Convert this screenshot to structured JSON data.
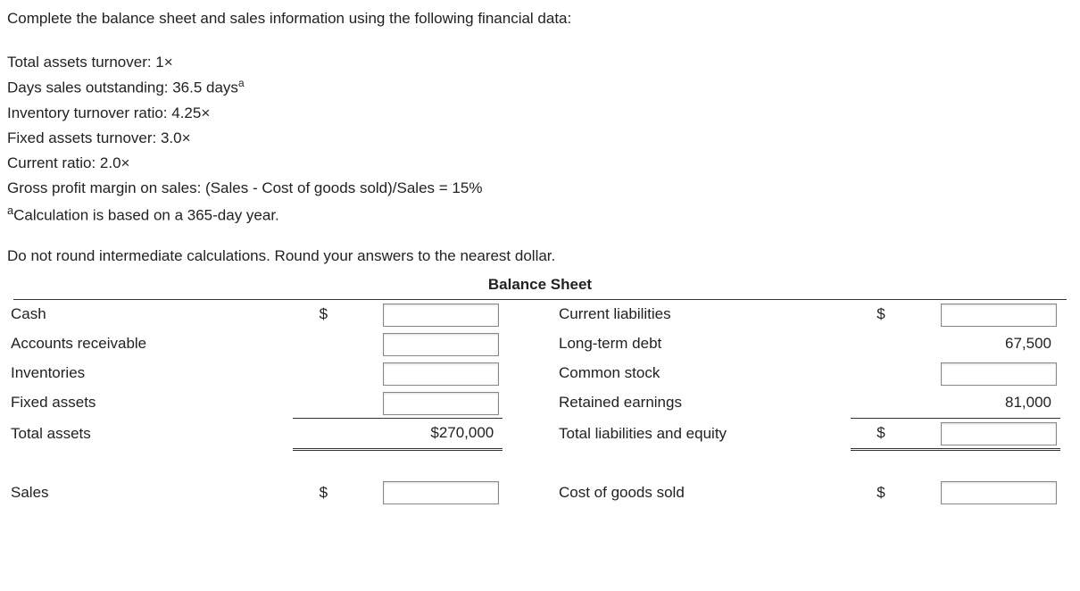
{
  "intro": "Complete the balance sheet and sales information using the following financial data:",
  "data_lines": {
    "line1": "Total assets turnover: 1×",
    "line2_pre": "Days sales outstanding: 36.5 days",
    "line2_sup": "a",
    "line3": "Inventory turnover ratio: 4.25×",
    "line4": "Fixed assets turnover: 3.0×",
    "line5": "Current ratio: 2.0×",
    "line6": "Gross profit margin on sales: (Sales - Cost of goods sold)/Sales = 15%",
    "footnote_sup": "a",
    "footnote": "Calculation is based on a 365-day year."
  },
  "instruction": "Do not round intermediate calculations. Round your answers to the nearest dollar.",
  "sheet_title": "Balance Sheet",
  "currency": "$",
  "rows": {
    "cash": "Cash",
    "ar": "Accounts receivable",
    "inv": "Inventories",
    "fa": "Fixed assets",
    "ta": "Total assets",
    "ta_val": "$270,000",
    "sales": "Sales",
    "cl": "Current liabilities",
    "ltd": "Long-term debt",
    "ltd_val": "67,500",
    "cs": "Common stock",
    "re": "Retained earnings",
    "re_val": "81,000",
    "tle": "Total liabilities and equity",
    "cogs": "Cost of goods sold"
  }
}
